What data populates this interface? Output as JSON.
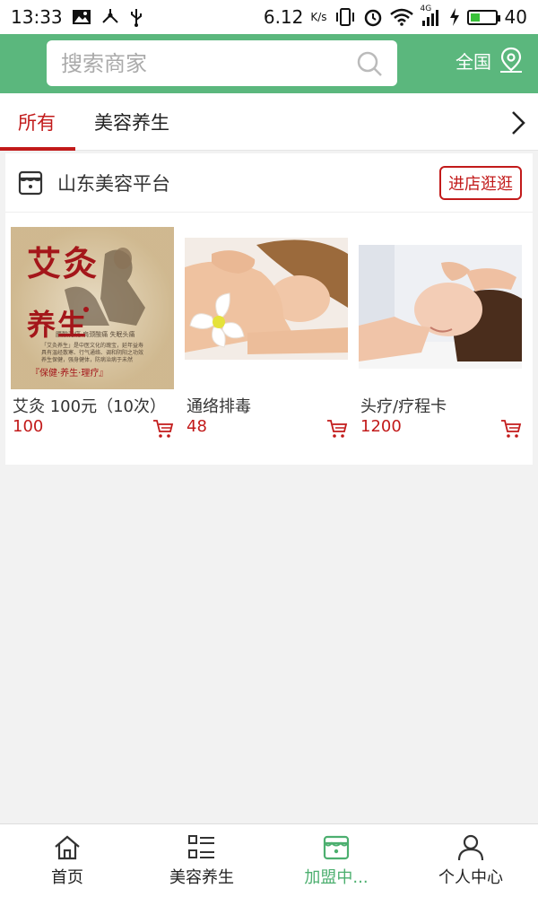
{
  "status_bar": {
    "time": "13:33",
    "net_speed": "6.12",
    "net_unit": "K/s",
    "signal_type": "4G",
    "battery": "40",
    "battery_fraction": 0.4,
    "icons": [
      "image-icon",
      "share-icon",
      "usb-icon",
      "vibrate-icon",
      "alarm-icon",
      "wifi-icon",
      "signal-icon",
      "charging-icon",
      "battery-icon"
    ]
  },
  "header": {
    "search_placeholder": "搜索商家",
    "region_label": "全国",
    "colors": {
      "brand_green": "#5bb77d"
    }
  },
  "tabs": {
    "items": [
      {
        "label": "所有",
        "active": true
      },
      {
        "label": "美容养生",
        "active": false
      }
    ],
    "accent": "#c21a1a"
  },
  "store": {
    "name": "山东美容平台",
    "visit_label": "进店逛逛",
    "products": [
      {
        "name": "艾灸 100元（10次）",
        "price": "100",
        "image": "moxibustion-poster"
      },
      {
        "name": "通络排毒",
        "price": "48",
        "image": "back-massage-photo"
      },
      {
        "name": "头疗/疗程卡",
        "price": "1200",
        "image": "head-therapy-photo"
      }
    ],
    "poster_text": {
      "title_line1": "艾灸",
      "title_line2": "养生",
      "bottom": "『保健·养生·理疗』"
    }
  },
  "bottom_nav": {
    "items": [
      {
        "label": "首页",
        "icon": "home-icon",
        "active": false
      },
      {
        "label": "美容养生",
        "icon": "grid-list-icon",
        "active": false
      },
      {
        "label": "加盟中...",
        "icon": "storefront-icon",
        "active": true
      },
      {
        "label": "个人中心",
        "icon": "person-icon",
        "active": false
      }
    ],
    "active_color": "#4caf6f"
  }
}
